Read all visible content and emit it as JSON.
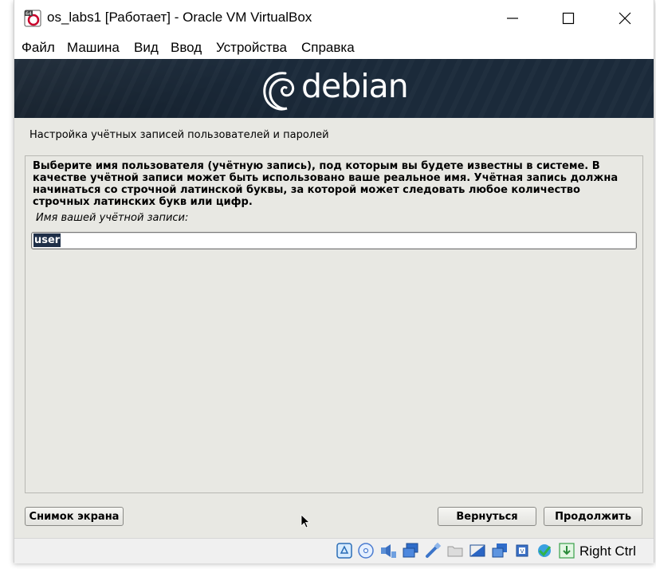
{
  "window": {
    "title": "os_labs1 [Работает] - Oracle VM VirtualBox",
    "app_icon_label": "64"
  },
  "menu": [
    "Файл",
    "Машина",
    "Вид",
    "Ввод",
    "Устройства",
    "Справка"
  ],
  "banner": {
    "logo_text": "debian"
  },
  "installer": {
    "section_title": "Настройка учётных записей пользователей и паролей",
    "description": "Выберите имя пользователя (учётную запись), под которым вы будете известны в системе. В качестве учётной записи может быть использовано ваше реальное имя. Учётная запись должна начинаться со строчной латинской буквы, за которой может следовать любое количество строчных латинских букв или цифр.",
    "field_label": "Имя вашей учётной записи:",
    "username_value": "user"
  },
  "buttons": {
    "screenshot": "Снимок экрана",
    "back": "Вернуться",
    "continue": "Продолжить"
  },
  "statusbar": {
    "icons": [
      "hard-disk-icon",
      "optical-disk-icon",
      "audio-icon",
      "network-icon",
      "usb-icon",
      "shared-folders-icon",
      "display-icon",
      "video-capture-icon",
      "cpu-icon",
      "guest-additions-icon",
      "keyboard-capture-icon"
    ],
    "host_key": "Right Ctrl"
  },
  "colors": {
    "banner": "#1b2a3a",
    "installer_bg": "#e8e8e3",
    "selection": "#1f2f48"
  }
}
